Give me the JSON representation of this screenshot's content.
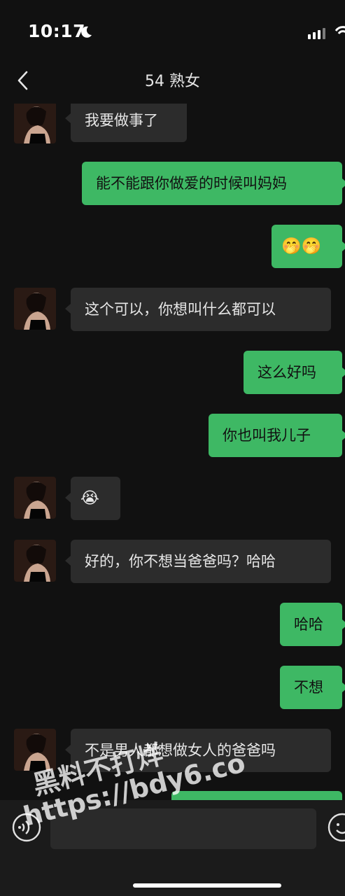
{
  "status_bar": {
    "time": "10:17"
  },
  "header": {
    "title": "54 熟女"
  },
  "messages": [
    {
      "side": "in",
      "text": "我要做事了"
    },
    {
      "side": "out",
      "text": "能不能跟你做爱的时候叫妈妈"
    },
    {
      "side": "out",
      "text": "🤭🤭"
    },
    {
      "side": "in",
      "text": "这个可以，你想叫什么都可以"
    },
    {
      "side": "out",
      "text": "这么好吗"
    },
    {
      "side": "out",
      "text": "你也叫我儿子"
    },
    {
      "side": "in",
      "text": "😭"
    },
    {
      "side": "in",
      "text": "好的，你不想当爸爸吗？哈哈"
    },
    {
      "side": "out",
      "text": "哈哈"
    },
    {
      "side": "out",
      "text": "不想"
    },
    {
      "side": "in",
      "text": "不是男人都想做女人的爸爸吗"
    }
  ],
  "input_bar": {
    "text_value": ""
  },
  "watermark": {
    "line1": "黑料不打烊",
    "line2": "https://bdy6.co"
  },
  "icons": {
    "back": "chevron-left-icon",
    "voice": "voice-icon",
    "emoji": "emoji-icon",
    "signal": "signal-icon",
    "wifi": "wifi-icon",
    "moon": "moon-icon"
  },
  "colors": {
    "background": "#111111",
    "incoming_bubble": "#2c2c2c",
    "outgoing_bubble": "#3eb864",
    "input_bar": "#1b1b1b"
  }
}
